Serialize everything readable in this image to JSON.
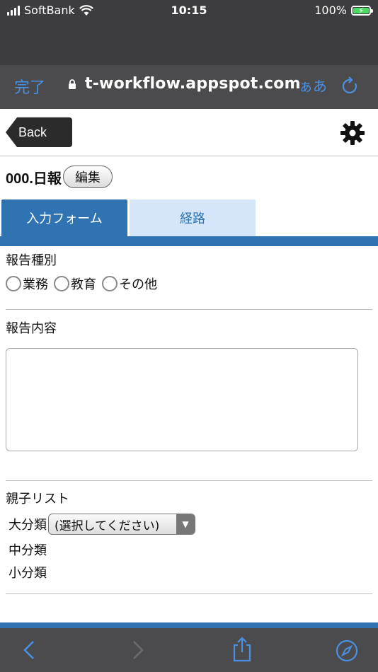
{
  "status": {
    "carrier": "SoftBank",
    "time": "10:15",
    "battery": "100%"
  },
  "browser": {
    "done_label": "完了",
    "url": "t-workflow.appspot.com",
    "text_size_label": "ぁあ"
  },
  "header": {
    "back_label": "Back"
  },
  "form": {
    "title": "000.日報",
    "edit_label": "編集",
    "tabs": [
      {
        "label": "入力フォーム",
        "active": true
      },
      {
        "label": "経路",
        "active": false
      }
    ],
    "report_type": {
      "label": "報告種別",
      "options": [
        "業務",
        "教育",
        "その他"
      ]
    },
    "report_content": {
      "label": "報告内容",
      "value": ""
    },
    "parent_child": {
      "label": "親子リスト",
      "large_label": "大分類",
      "large_selected": "(選択してください)",
      "medium_label": "中分類",
      "small_label": "小分類"
    }
  },
  "colors": {
    "accent": "#2f73b2",
    "tab_inactive": "#d4e6f7",
    "chrome": "#4b4b4d",
    "ios_link": "#4a90e2"
  }
}
